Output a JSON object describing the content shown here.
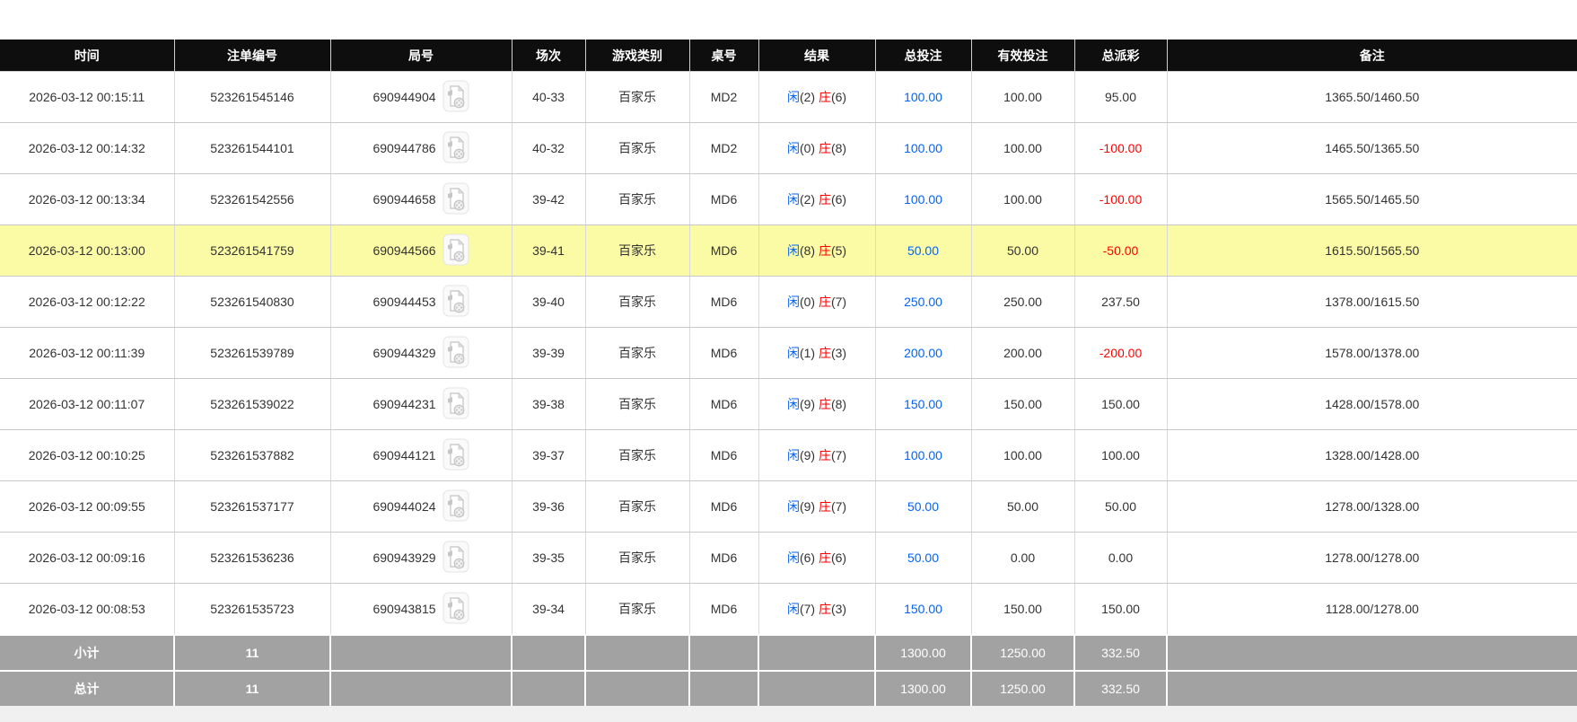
{
  "table": {
    "columns": [
      {
        "key": "time",
        "label": "时间"
      },
      {
        "key": "bet-id",
        "label": "注单编号"
      },
      {
        "key": "round",
        "label": "局号"
      },
      {
        "key": "session",
        "label": "场次"
      },
      {
        "key": "game-type",
        "label": "游戏类别"
      },
      {
        "key": "table-id",
        "label": "桌号"
      },
      {
        "key": "result",
        "label": "结果"
      },
      {
        "key": "total-bet",
        "label": "总投注"
      },
      {
        "key": "valid-bet",
        "label": "有效投注"
      },
      {
        "key": "payout",
        "label": "总派彩"
      },
      {
        "key": "remark",
        "label": "备注"
      }
    ],
    "icon_name": "video-replay-icon",
    "rows": [
      {
        "time": "2026-03-12 00:15:11",
        "bet_id": "523261545146",
        "round_id": "690944904",
        "session": "40-33",
        "game_type": "百家乐",
        "table_id": "MD2",
        "result": {
          "player_label": "闲",
          "player_value": "(2)",
          "banker_label": "庄",
          "banker_value": "(6)"
        },
        "total_bet": "100.00",
        "valid_bet": "100.00",
        "payout": "95.00",
        "remark": "1365.50/1460.50",
        "highlighted": false
      },
      {
        "time": "2026-03-12 00:14:32",
        "bet_id": "523261544101",
        "round_id": "690944786",
        "session": "40-32",
        "game_type": "百家乐",
        "table_id": "MD2",
        "result": {
          "player_label": "闲",
          "player_value": "(0)",
          "banker_label": "庄",
          "banker_value": "(8)"
        },
        "total_bet": "100.00",
        "valid_bet": "100.00",
        "payout": "-100.00",
        "remark": "1465.50/1365.50",
        "highlighted": false
      },
      {
        "time": "2026-03-12 00:13:34",
        "bet_id": "523261542556",
        "round_id": "690944658",
        "session": "39-42",
        "game_type": "百家乐",
        "table_id": "MD6",
        "result": {
          "player_label": "闲",
          "player_value": "(2)",
          "banker_label": "庄",
          "banker_value": "(6)"
        },
        "total_bet": "100.00",
        "valid_bet": "100.00",
        "payout": "-100.00",
        "remark": "1565.50/1465.50",
        "highlighted": false
      },
      {
        "time": "2026-03-12 00:13:00",
        "bet_id": "523261541759",
        "round_id": "690944566",
        "session": "39-41",
        "game_type": "百家乐",
        "table_id": "MD6",
        "result": {
          "player_label": "闲",
          "player_value": "(8)",
          "banker_label": "庄",
          "banker_value": "(5)"
        },
        "total_bet": "50.00",
        "valid_bet": "50.00",
        "payout": "-50.00",
        "remark": "1615.50/1565.50",
        "highlighted": true
      },
      {
        "time": "2026-03-12 00:12:22",
        "bet_id": "523261540830",
        "round_id": "690944453",
        "session": "39-40",
        "game_type": "百家乐",
        "table_id": "MD6",
        "result": {
          "player_label": "闲",
          "player_value": "(0)",
          "banker_label": "庄",
          "banker_value": "(7)"
        },
        "total_bet": "250.00",
        "valid_bet": "250.00",
        "payout": "237.50",
        "remark": "1378.00/1615.50",
        "highlighted": false
      },
      {
        "time": "2026-03-12 00:11:39",
        "bet_id": "523261539789",
        "round_id": "690944329",
        "session": "39-39",
        "game_type": "百家乐",
        "table_id": "MD6",
        "result": {
          "player_label": "闲",
          "player_value": "(1)",
          "banker_label": "庄",
          "banker_value": "(3)"
        },
        "total_bet": "200.00",
        "valid_bet": "200.00",
        "payout": "-200.00",
        "remark": "1578.00/1378.00",
        "highlighted": false
      },
      {
        "time": "2026-03-12 00:11:07",
        "bet_id": "523261539022",
        "round_id": "690944231",
        "session": "39-38",
        "game_type": "百家乐",
        "table_id": "MD6",
        "result": {
          "player_label": "闲",
          "player_value": "(9)",
          "banker_label": "庄",
          "banker_value": "(8)"
        },
        "total_bet": "150.00",
        "valid_bet": "150.00",
        "payout": "150.00",
        "remark": "1428.00/1578.00",
        "highlighted": false
      },
      {
        "time": "2026-03-12 00:10:25",
        "bet_id": "523261537882",
        "round_id": "690944121",
        "session": "39-37",
        "game_type": "百家乐",
        "table_id": "MD6",
        "result": {
          "player_label": "闲",
          "player_value": "(9)",
          "banker_label": "庄",
          "banker_value": "(7)"
        },
        "total_bet": "100.00",
        "valid_bet": "100.00",
        "payout": "100.00",
        "remark": "1328.00/1428.00",
        "highlighted": false
      },
      {
        "time": "2026-03-12 00:09:55",
        "bet_id": "523261537177",
        "round_id": "690944024",
        "session": "39-36",
        "game_type": "百家乐",
        "table_id": "MD6",
        "result": {
          "player_label": "闲",
          "player_value": "(9)",
          "banker_label": "庄",
          "banker_value": "(7)"
        },
        "total_bet": "50.00",
        "valid_bet": "50.00",
        "payout": "50.00",
        "remark": "1278.00/1328.00",
        "highlighted": false
      },
      {
        "time": "2026-03-12 00:09:16",
        "bet_id": "523261536236",
        "round_id": "690943929",
        "session": "39-35",
        "game_type": "百家乐",
        "table_id": "MD6",
        "result": {
          "player_label": "闲",
          "player_value": "(6)",
          "banker_label": "庄",
          "banker_value": "(6)"
        },
        "total_bet": "50.00",
        "valid_bet": "0.00",
        "payout": "0.00",
        "remark": "1278.00/1278.00",
        "highlighted": false
      },
      {
        "time": "2026-03-12 00:08:53",
        "bet_id": "523261535723",
        "round_id": "690943815",
        "session": "39-34",
        "game_type": "百家乐",
        "table_id": "MD6",
        "result": {
          "player_label": "闲",
          "player_value": "(7)",
          "banker_label": "庄",
          "banker_value": "(3)"
        },
        "total_bet": "150.00",
        "valid_bet": "150.00",
        "payout": "150.00",
        "remark": "1128.00/1278.00",
        "highlighted": false
      }
    ],
    "footer": [
      {
        "key": "subtotal",
        "label": "小计",
        "count": "11",
        "total_bet": "1300.00",
        "valid_bet": "1250.00",
        "payout": "332.50"
      },
      {
        "key": "total",
        "label": "总计",
        "count": "11",
        "total_bet": "1300.00",
        "valid_bet": "1250.00",
        "payout": "332.50"
      }
    ]
  },
  "colors": {
    "player_blue": "#0663f3",
    "banker_red": "#ff0000",
    "negative_red": "#ff0000",
    "highlight_yellow": "#fbfba6",
    "header_bg": "#0e0e0e",
    "footer_bg": "#a2a2a2"
  }
}
